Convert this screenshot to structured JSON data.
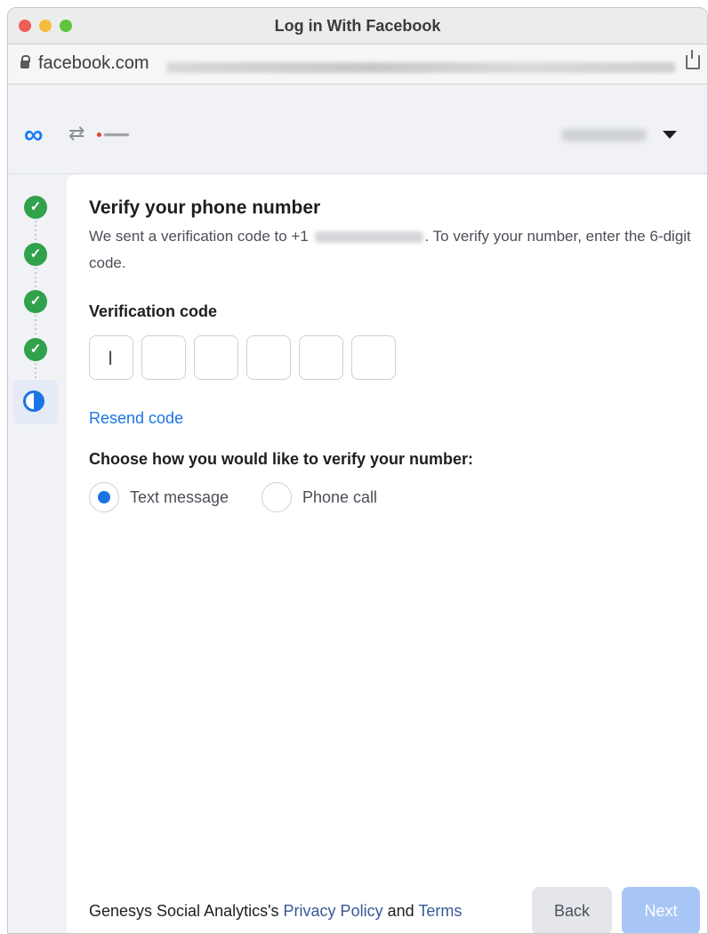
{
  "window": {
    "title": "Log in With Facebook"
  },
  "address_bar": {
    "domain": "facebook.com"
  },
  "header": {
    "meta_icon": "meta-logo",
    "sync_icon": "sync-arrows-icon"
  },
  "stepper": {
    "completed_steps": 4,
    "check_glyph": "✓"
  },
  "verify": {
    "title": "Verify your phone number",
    "desc_prefix": "We sent a verification code to +1",
    "desc_suffix": ". To verify your number, enter the 6-digit code.",
    "code_label": "Verification code",
    "code_digits": [
      "",
      "",
      "",
      "",
      "",
      ""
    ],
    "resend": "Resend code",
    "method_label": "Choose how you would like to verify your number:",
    "methods": [
      {
        "label": "Text message",
        "selected": true
      },
      {
        "label": "Phone call",
        "selected": false
      }
    ]
  },
  "footer": {
    "company": "Genesys Social Analytics's",
    "privacy": "Privacy Policy",
    "and": "and",
    "terms": "Terms",
    "back": "Back",
    "next": "Next"
  },
  "colors": {
    "accent": "#1b74e4",
    "success": "#31a24c",
    "next_disabled": "#a7c6f5"
  }
}
